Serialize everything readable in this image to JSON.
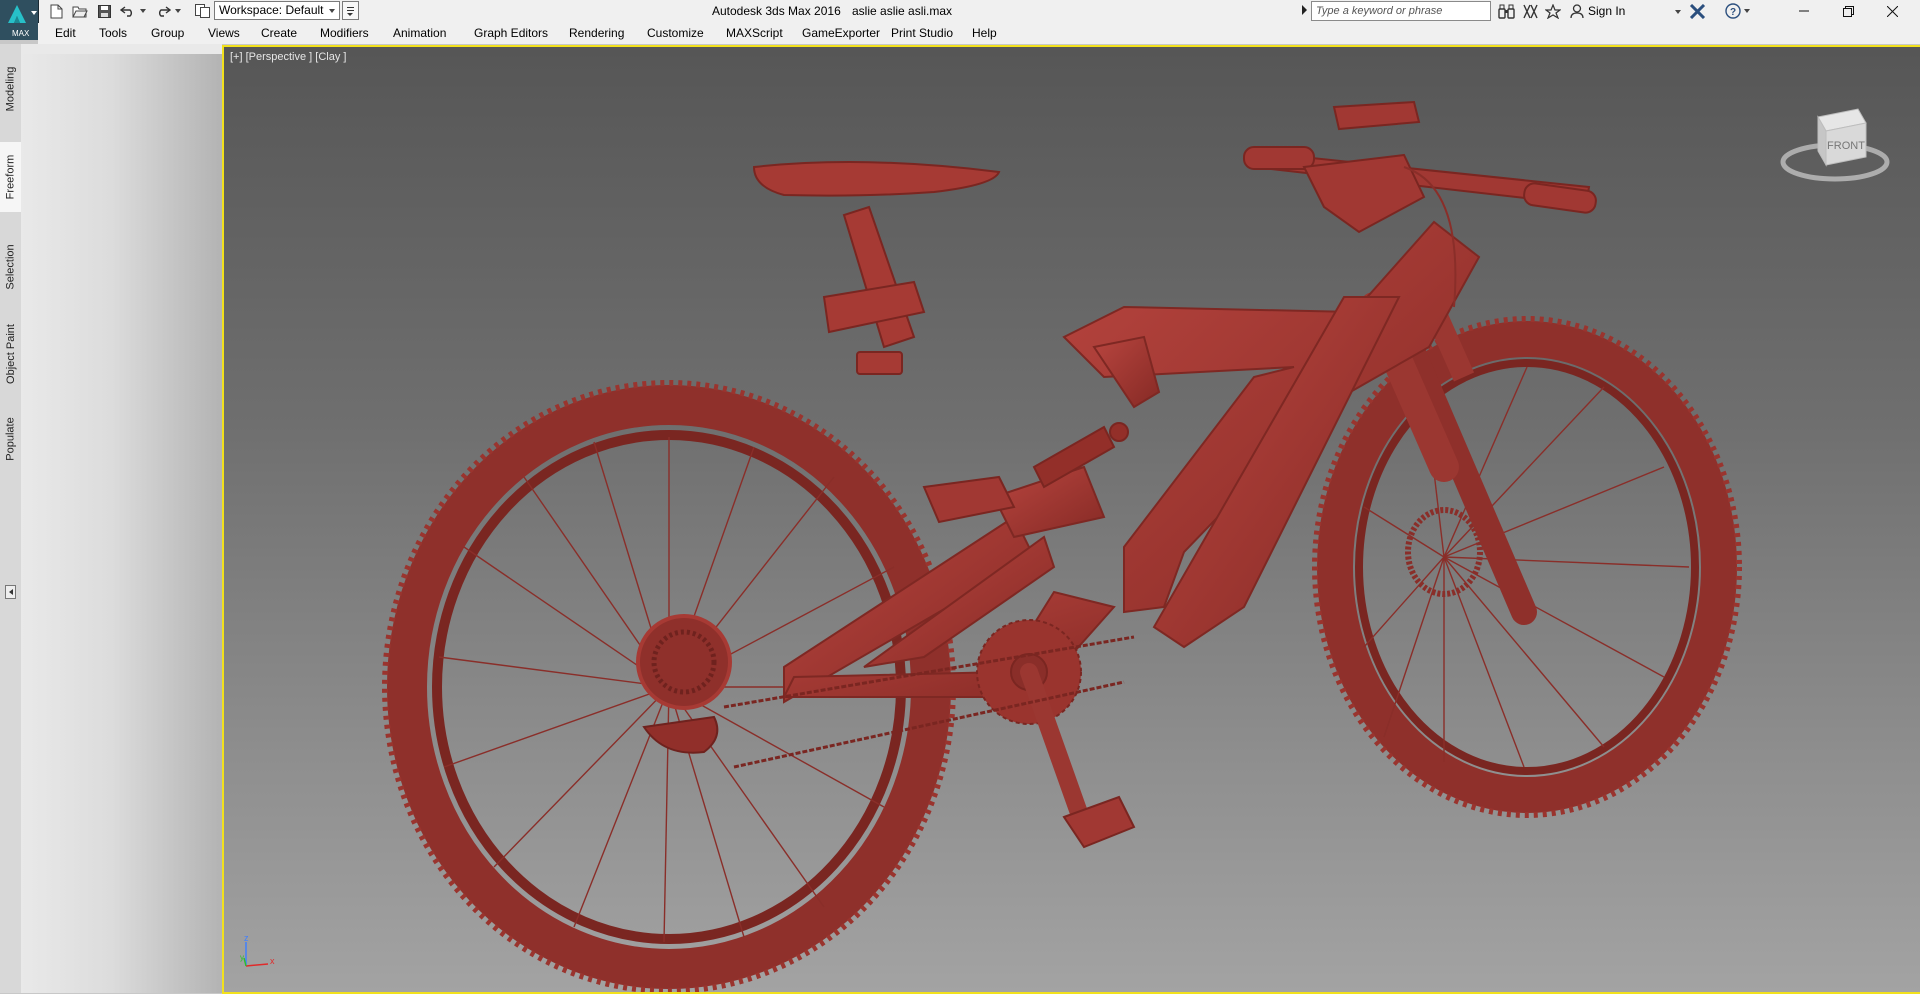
{
  "titlebar": {
    "logo_label": "MAX",
    "workspace": "Workspace: Default",
    "app_title": "Autodesk 3ds Max 2016",
    "file_title": "aslie aslie asli.max",
    "search_placeholder": "Type a keyword or phrase",
    "sign_in": "Sign In"
  },
  "menubar": {
    "items": [
      "Edit",
      "Tools",
      "Group",
      "Views",
      "Create",
      "Modifiers",
      "Animation",
      "Graph Editors",
      "Rendering",
      "Customize",
      "MAXScript",
      "GameExporter",
      "Print Studio",
      "Help"
    ]
  },
  "ribbon": {
    "tabs": [
      "Modeling",
      "Freeform",
      "Selection",
      "Object Paint",
      "Populate"
    ],
    "active_tab": "Freeform"
  },
  "viewport": {
    "label": "[+] [Perspective ] [Clay ]",
    "viewcube_face": "FRONT",
    "axis_z": "z",
    "axis_x": "x",
    "axis_y": "y",
    "model_color": "#a73a34",
    "border_color": "#f2e11c"
  }
}
